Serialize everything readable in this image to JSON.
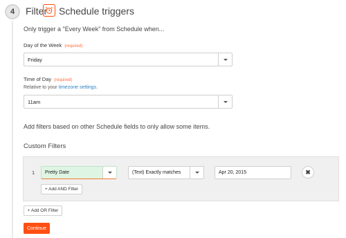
{
  "step": {
    "number": "4",
    "title": "Filter",
    "app_icon": "alarm-clock-icon",
    "app_name": "Schedule triggers",
    "accent_color": "#ff4a00"
  },
  "intro_text": "Only trigger a \"Every Week\" from Schedule when...",
  "day_of_week": {
    "label": "Day of the Week",
    "required_tag": "(required)",
    "value": "Friday"
  },
  "time_of_day": {
    "label": "Time of Day",
    "required_tag": "(required)",
    "helper_prefix": "Relative to your ",
    "helper_link": "timezone settings",
    "helper_suffix": ".",
    "value": "11am"
  },
  "filters_note": "Add filters based on other Schedule fields to only allow some items.",
  "custom_filters": {
    "title": "Custom Filters",
    "rows": [
      {
        "number": "1",
        "field": "Pretty Date",
        "condition": "(Text) Exactly matches",
        "value": "Apr 20, 2015",
        "remove_icon": "close-icon"
      }
    ],
    "add_and_label": "+ Add AND Filter"
  },
  "add_or_label": "+ Add OR Filter",
  "continue_label": "Continue"
}
